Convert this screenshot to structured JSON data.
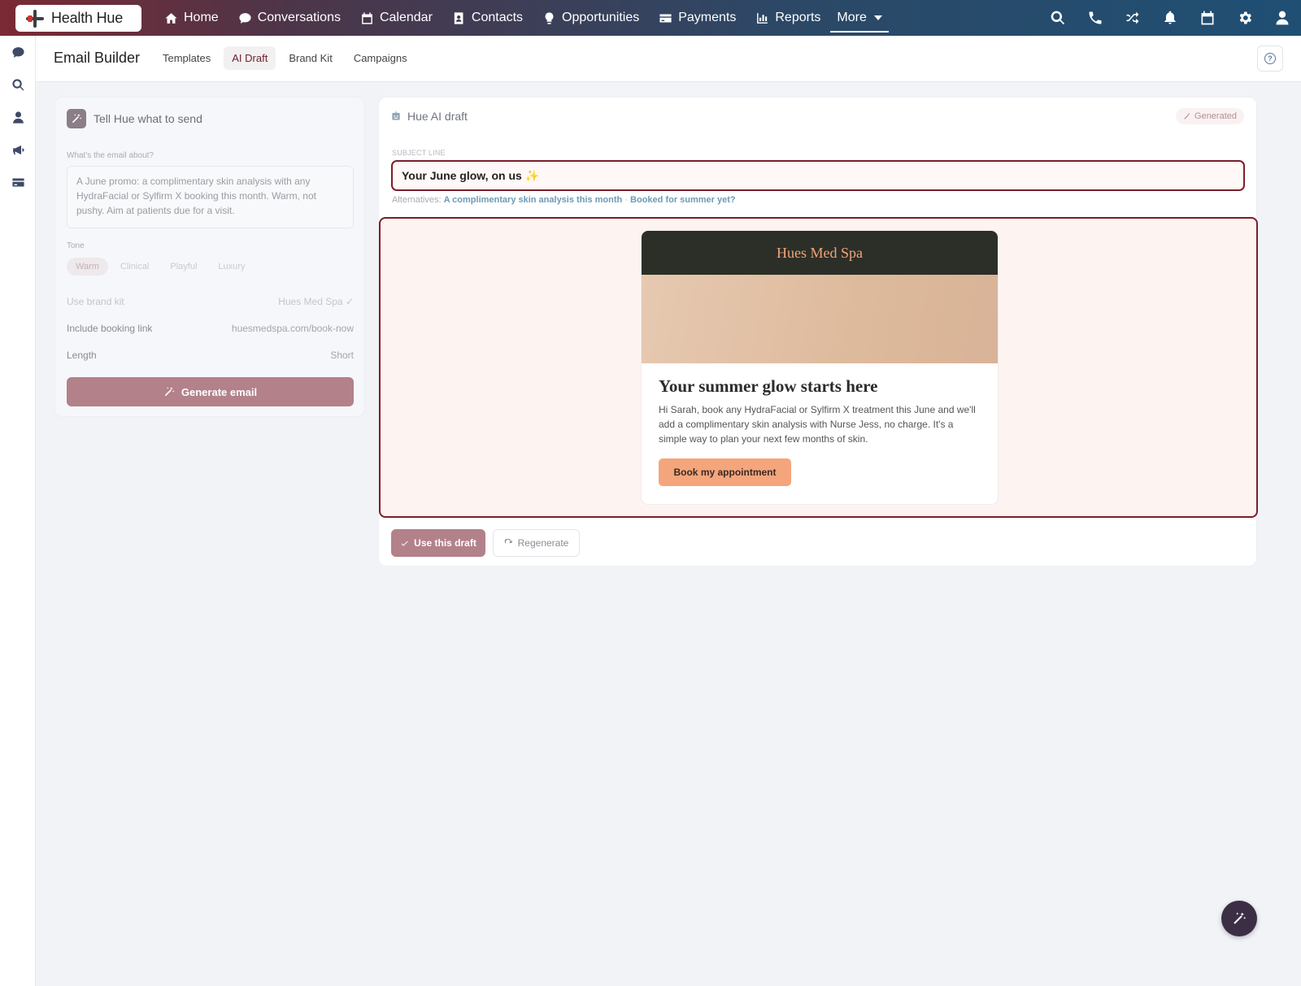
{
  "brand": {
    "name": "Health Hue"
  },
  "nav": {
    "items": [
      {
        "label": "Home",
        "icon": "home-icon"
      },
      {
        "label": "Conversations",
        "icon": "chat-icon"
      },
      {
        "label": "Calendar",
        "icon": "calendar-icon"
      },
      {
        "label": "Contacts",
        "icon": "contacts-icon"
      },
      {
        "label": "Opportunities",
        "icon": "lightbulb-icon"
      },
      {
        "label": "Payments",
        "icon": "credit-card-icon"
      },
      {
        "label": "Reports",
        "icon": "bar-chart-icon"
      },
      {
        "label": "More",
        "icon": "chevron-down-icon"
      }
    ],
    "right_icons": [
      "search-icon",
      "phone-icon",
      "shuffle-icon",
      "bell-icon",
      "calendar-icon",
      "gear-icon",
      "user-icon"
    ]
  },
  "rail": {
    "icons": [
      "chat-icon",
      "search-icon",
      "user-icon",
      "megaphone-icon",
      "credit-card-icon"
    ]
  },
  "header": {
    "title": "Email Builder",
    "tabs": [
      "Templates",
      "AI Draft",
      "Brand Kit",
      "Campaigns"
    ],
    "active_tab": "AI Draft"
  },
  "prompt_panel": {
    "title": "Tell Hue what to send",
    "about_label": "What's the email about?",
    "about_value": "A June promo: a complimentary skin analysis with any HydraFacial or Sylfirm X booking this month. Warm, not pushy. Aim at patients due for a visit.",
    "tone_label": "Tone",
    "tones": [
      "Warm",
      "Clinical",
      "Playful",
      "Luxury"
    ],
    "selected_tone": "Warm",
    "brand_kit_label": "Use brand kit",
    "brand_kit_value": "Hues Med Spa",
    "booking_label": "Include booking link",
    "booking_value": "huesmedspa.com/book-now",
    "length_label": "Length",
    "length_value": "Short",
    "generate_label": "Generate email"
  },
  "draft_panel": {
    "title": "Hue AI draft",
    "badge": "Generated",
    "subject_label": "SUBJECT LINE",
    "subject_value": "Your June glow, on us ✨",
    "alternatives_label": "Alternatives:",
    "alternatives": [
      "A complimentary skin analysis this month",
      "Booked for summer yet?"
    ],
    "alt_separator": "·",
    "email": {
      "brand": "Hues Med Spa",
      "headline": "Your summer glow starts here",
      "body": "Hi Sarah, book any HydraFacial or Sylfirm X treatment this June and we'll add a complimentary skin analysis with Nurse Jess, no charge. It's a simple way to plan your next few months of skin.",
      "cta": "Book my appointment"
    },
    "use_label": "Use this draft",
    "regen_label": "Regenerate"
  },
  "colors": {
    "accent": "#7a1f2b",
    "button": "#b3818a",
    "email_header": "#2c2f27",
    "email_brand_text": "#f2a47a",
    "cta": "#f4a57c",
    "link": "#6c9ab8"
  }
}
